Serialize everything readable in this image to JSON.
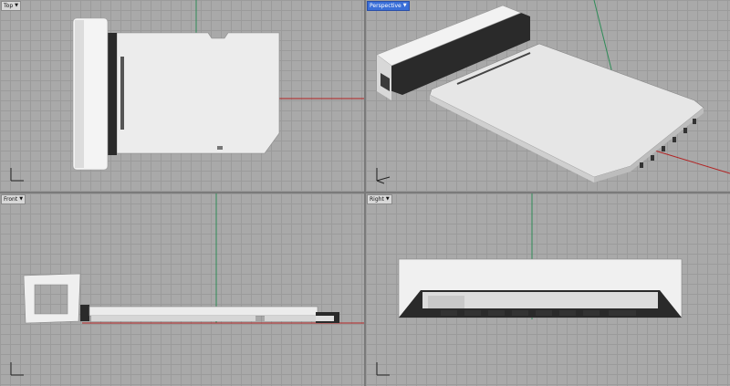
{
  "viewports": [
    {
      "id": "top",
      "label": "Top",
      "active": false
    },
    {
      "id": "perspective",
      "label": "Perspective",
      "active": true
    },
    {
      "id": "front",
      "label": "Front",
      "active": false
    },
    {
      "id": "right",
      "label": "Right",
      "active": false
    }
  ],
  "colors": {
    "background": "#a9a9a9",
    "grid": "#9b9b9b",
    "x_axis": "#b22222",
    "y_axis": "#2e8b57",
    "model_face": "#e8e8e8",
    "model_shadow": "#2a2a2a",
    "active_tab": "#3a6fd8"
  },
  "icons": [
    "dropdown-arrow-icon",
    "axis-widget-icon"
  ]
}
